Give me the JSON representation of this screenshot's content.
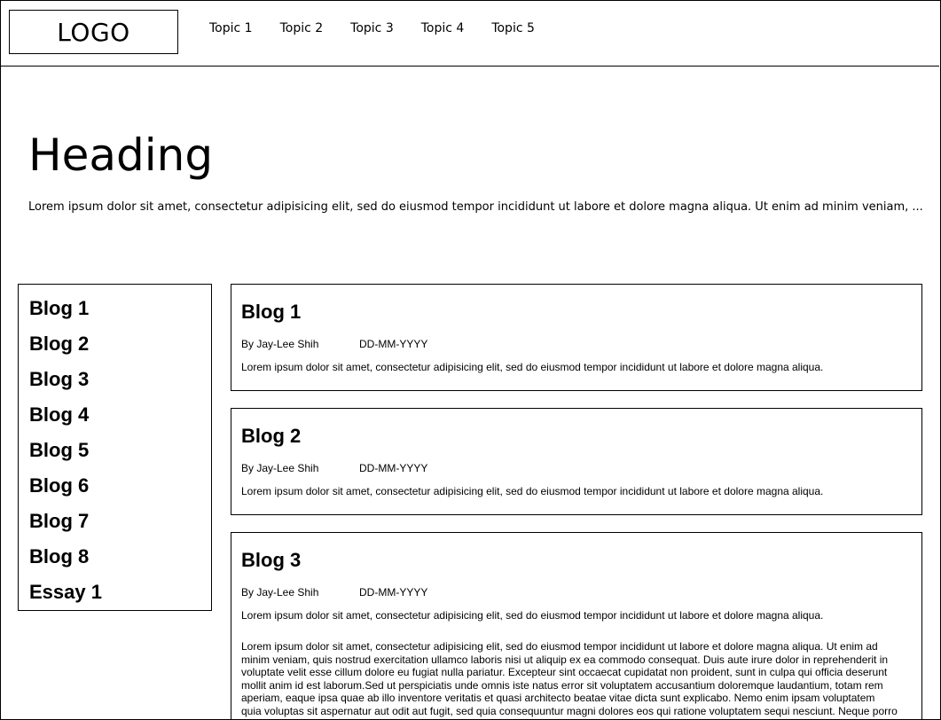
{
  "header": {
    "logo": "LOGO",
    "nav": [
      "Topic 1",
      "Topic 2",
      "Topic 3",
      "Topic 4",
      "Topic 5"
    ]
  },
  "hero": {
    "heading": "Heading",
    "text": "Lorem ipsum dolor sit amet, consectetur adipisicing elit, sed do eiusmod tempor incididunt ut labore et dolore magna aliqua. Ut enim ad minim veniam, ..."
  },
  "sidebar": {
    "items": [
      "Blog 1",
      "Blog 2",
      "Blog 3",
      "Blog 4",
      "Blog 5",
      "Blog 6",
      "Blog 7",
      "Blog 8",
      "Essay 1"
    ]
  },
  "posts": [
    {
      "title": "Blog 1",
      "author": "By Jay-Lee Shih",
      "date": "DD-MM-YYYY",
      "excerpt": "Lorem ipsum dolor sit amet, consectetur adipisicing elit, sed do eiusmod tempor incididunt ut labore et dolore magna aliqua."
    },
    {
      "title": "Blog 2",
      "author": "By Jay-Lee Shih",
      "date": "DD-MM-YYYY",
      "excerpt": "Lorem ipsum dolor sit amet, consectetur adipisicing elit, sed do eiusmod tempor incididunt ut labore et dolore magna aliqua."
    },
    {
      "title": "Blog 3",
      "author": "By Jay-Lee Shih",
      "date": "DD-MM-YYYY",
      "excerpt": "Lorem ipsum dolor sit amet, consectetur adipisicing elit, sed do eiusmod tempor incididunt ut labore et dolore magna aliqua.",
      "body": "Lorem ipsum dolor sit amet, consectetur adipisicing elit, sed do eiusmod tempor incididunt ut labore et dolore magna aliqua. Ut enim ad minim veniam, quis nostrud exercitation ullamco laboris nisi ut aliquip ex ea commodo consequat. Duis aute irure dolor in reprehenderit in voluptate velit esse cillum dolore eu fugiat nulla pariatur. Excepteur sint occaecat cupidatat non proident, sunt in culpa qui officia deserunt mollit anim id est laborum.Sed ut perspiciatis unde omnis iste natus error sit voluptatem accusantium doloremque laudantium, totam rem aperiam, eaque ipsa quae ab illo inventore veritatis et quasi architecto beatae vitae dicta sunt explicabo. Nemo enim ipsam voluptatem quia voluptas sit aspernatur aut odit aut fugit, sed quia consequuntur magni dolores eos qui ratione voluptatem sequi nesciunt. Neque porro"
    }
  ]
}
